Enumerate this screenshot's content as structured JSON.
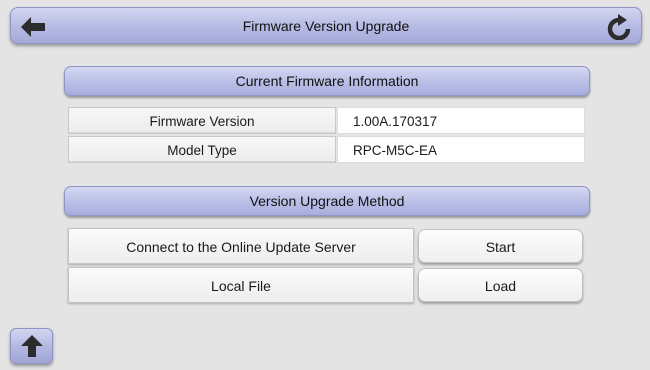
{
  "header": {
    "title": "Firmware Version Upgrade",
    "back_icon": "left-arrow-icon",
    "refresh_icon": "refresh-icon"
  },
  "firmware_info": {
    "section_title": "Current Firmware Information",
    "rows": [
      {
        "label": "Firmware Version",
        "value": "1.00A.170317"
      },
      {
        "label": "Model Type",
        "value": "RPC-M5C-EA"
      }
    ]
  },
  "upgrade_method": {
    "section_title": "Version Upgrade Method",
    "options": [
      {
        "label": "Connect to the Online Update Server",
        "button": "Start"
      },
      {
        "label": "Local File",
        "button": "Load"
      }
    ]
  },
  "footer": {
    "up_icon": "up-arrow-icon"
  },
  "colors": {
    "background": "#e4e4e4",
    "header_gradient_top": "#d3d6f0",
    "header_gradient_bottom": "#a4aad9",
    "icon": "#2c2c2c"
  }
}
